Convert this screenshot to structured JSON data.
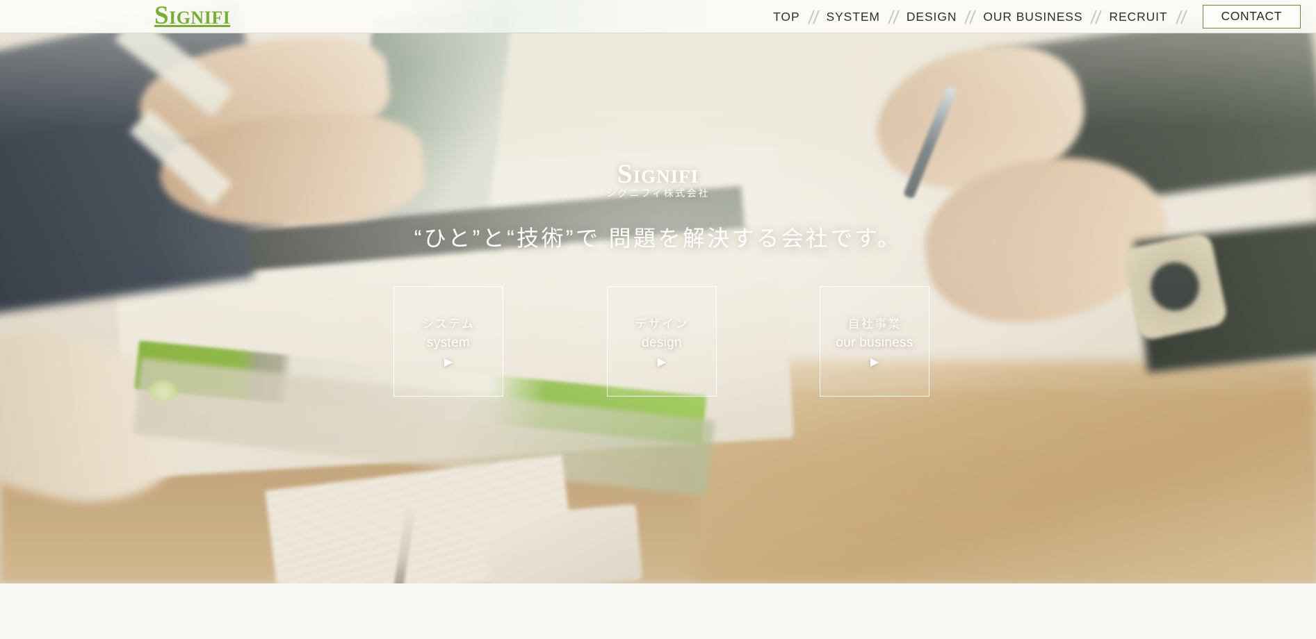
{
  "header": {
    "logo_text": "Signifi",
    "logo_color": "#76b02d",
    "nav_items": [
      {
        "label": "TOP"
      },
      {
        "label": "SYSTEM"
      },
      {
        "label": "DESIGN"
      },
      {
        "label": "OUR BUSINESS"
      },
      {
        "label": "RECRUIT"
      }
    ],
    "separator_glyph": "//",
    "contact_label": "CONTACT",
    "contact_border_color": "#5f8f3b"
  },
  "hero": {
    "logo_text": "Signifi",
    "logo_subtitle": "シグニフィ株式会社",
    "tagline": "“ひと”と“技術”で 問題を解決する会社です。",
    "background_description": "office desk photo: hands typing on laptop, hands with pen and wristwatch, green book, papers",
    "text_color": "#ffffff",
    "cards": [
      {
        "jp": "システム",
        "en": "system",
        "arrow": "▶",
        "icon": "play-triangle-icon"
      },
      {
        "jp": "デザイン",
        "en": "design",
        "arrow": "▶",
        "icon": "play-triangle-icon"
      },
      {
        "jp": "自社事業",
        "en": "our business",
        "arrow": "▶",
        "icon": "play-triangle-icon"
      }
    ]
  },
  "below_section": {
    "background_color": "#f8f8f4"
  }
}
